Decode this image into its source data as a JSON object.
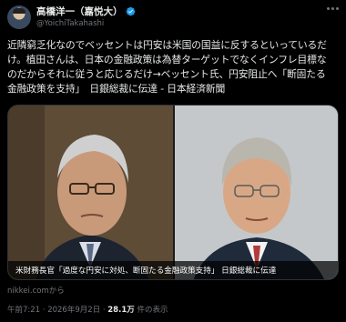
{
  "author": {
    "display_name": "高橋洋一（嘉悦大）",
    "handle": "@YoichiTakahashi",
    "verified_color": "#1d9bf0"
  },
  "tweet": {
    "lines": [
      "近隣窮乏化なのでベッセントは円安は米国の国益に反するといっているだ",
      "け。植田さんは、日本の金融政策は為替ターゲットでなくインフレ目標な",
      "のだからそれに従うと応じるだけ→ベッセント氏、円安阻止へ「断固たる",
      "金融政策を支持」　日銀総裁に伝達 - 日本経済新聞"
    ]
  },
  "media": {
    "caption": "米財務長官「過度な円安に対処、断固たる金融政策支持」 日銀総裁に伝達",
    "source": "nikkei.comから"
  },
  "meta": {
    "time": "午前7:21",
    "sep1": "·",
    "date": "2026年9月2日",
    "sep2": "·",
    "views_count": "28.1万",
    "views_label": "件の表示"
  }
}
